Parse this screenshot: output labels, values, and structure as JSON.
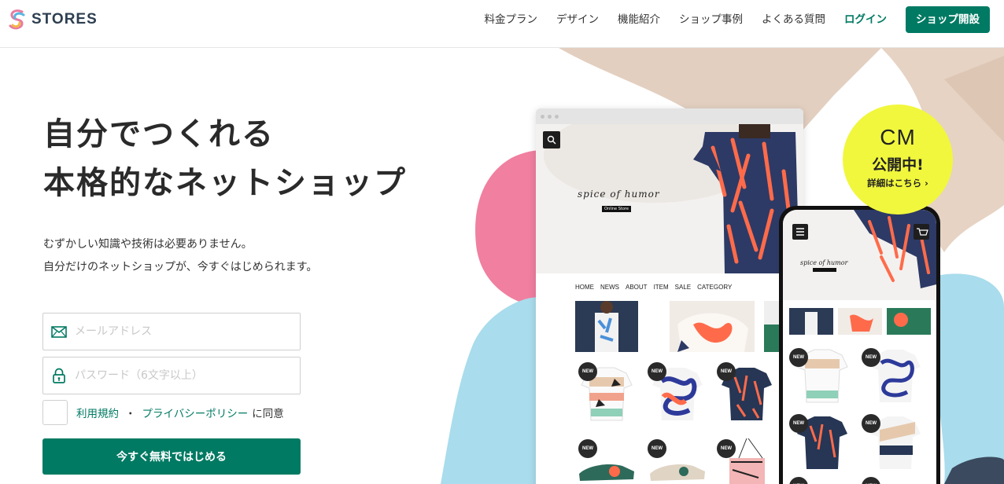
{
  "header": {
    "logo_text": "STORES",
    "nav": [
      {
        "label": "料金プラン"
      },
      {
        "label": "デザイン"
      },
      {
        "label": "機能紹介"
      },
      {
        "label": "ショップ事例"
      },
      {
        "label": "よくある質問"
      },
      {
        "label": "ログイン"
      }
    ],
    "cta_label": "ショップ開設"
  },
  "hero": {
    "headline_line1": "自分でつくれる",
    "headline_line2": "本格的なネットショップ",
    "sub_line1": "むずかしい知識や技術は必要ありません。",
    "sub_line2": "自分だけのネットショップが、今すぐはじめられます。"
  },
  "form": {
    "email_placeholder": "メールアドレス",
    "password_placeholder": "パスワード（6文字以上）",
    "terms_link": "利用規約",
    "separator": "・",
    "privacy_link": "プライバシーポリシー",
    "agree_suffix": "に同意",
    "submit_label": "今すぐ無料ではじめる"
  },
  "mockup": {
    "brand_name": "spice of humor",
    "brand_tag": "Online Store",
    "shop_nav": [
      "HOME",
      "NEWS",
      "ABOUT",
      "ITEM",
      "SALE",
      "CATEGORY"
    ],
    "new_badge": "NEW"
  },
  "cm_badge": {
    "line1": "CM",
    "line2": "公開中!",
    "line3": "詳細はこちら ›"
  },
  "colors": {
    "brand_green": "#007a63",
    "badge_yellow": "#f1f73c",
    "blob_pink": "#f07fa0",
    "blob_blue": "#a9dcec",
    "blob_beige": "#e3cfc0"
  }
}
